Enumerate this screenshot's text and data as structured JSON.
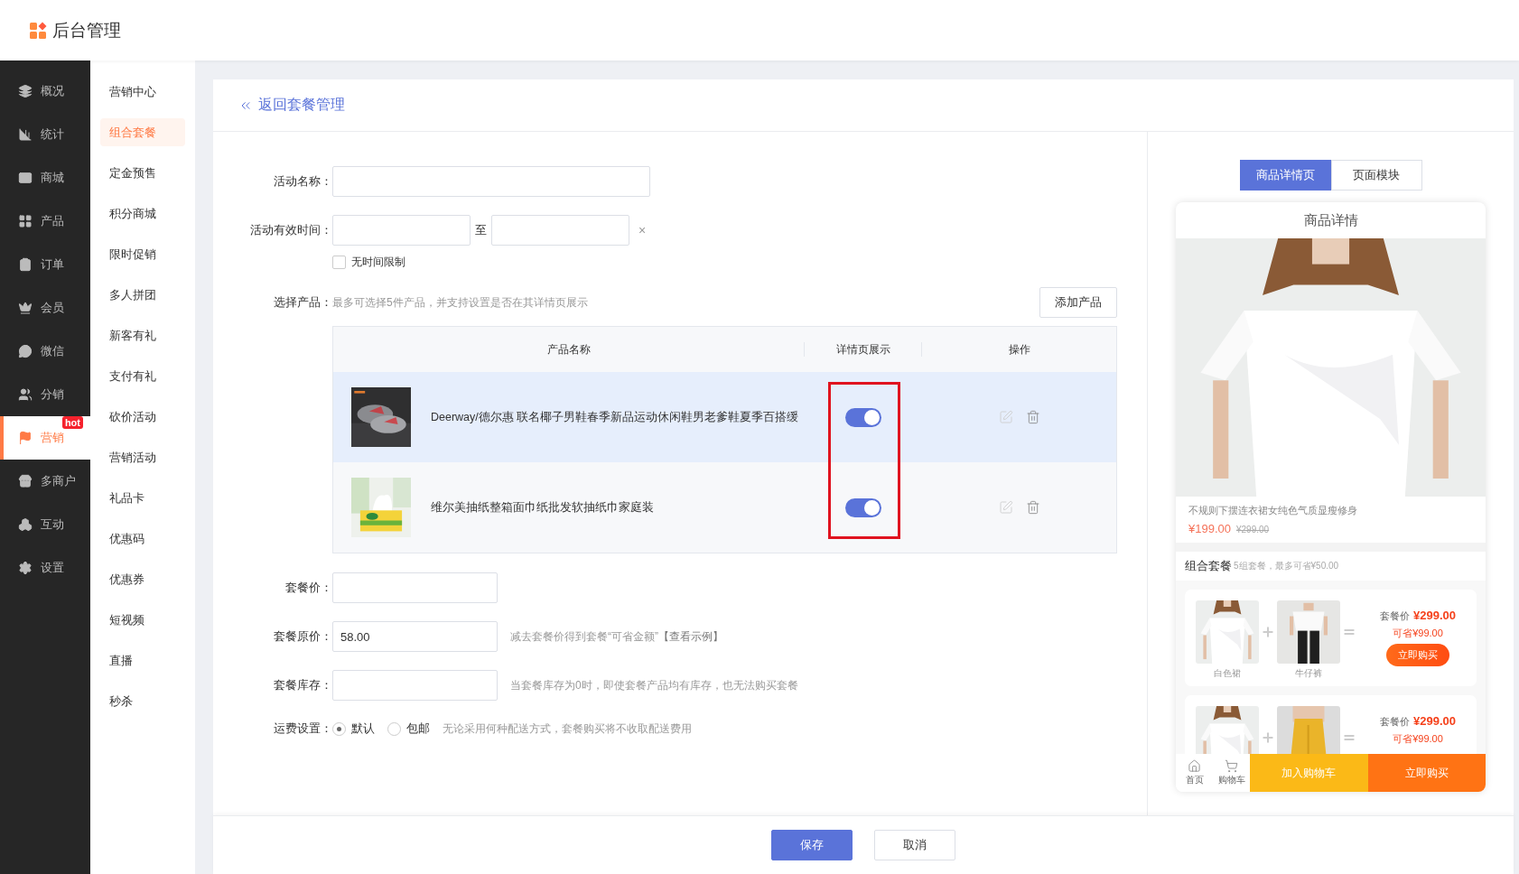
{
  "app": {
    "title": "后台管理"
  },
  "main_nav": [
    {
      "label": "概况",
      "selected": false
    },
    {
      "label": "统计",
      "selected": false
    },
    {
      "label": "商城",
      "selected": false
    },
    {
      "label": "产品",
      "selected": false
    },
    {
      "label": "订单",
      "selected": false
    },
    {
      "label": "会员",
      "selected": false
    },
    {
      "label": "微信",
      "selected": false
    },
    {
      "label": "分销",
      "selected": false
    },
    {
      "label": "营销",
      "selected": true,
      "badge": "hot"
    },
    {
      "label": "多商户",
      "selected": false
    },
    {
      "label": "互动",
      "selected": false
    },
    {
      "label": "设置",
      "selected": false
    }
  ],
  "sub_nav": [
    {
      "label": "营销中心",
      "selected": false
    },
    {
      "label": "组合套餐",
      "selected": true
    },
    {
      "label": "定金预售",
      "selected": false
    },
    {
      "label": "积分商城",
      "selected": false
    },
    {
      "label": "限时促销",
      "selected": false
    },
    {
      "label": "多人拼团",
      "selected": false
    },
    {
      "label": "新客有礼",
      "selected": false
    },
    {
      "label": "支付有礼",
      "selected": false
    },
    {
      "label": "砍价活动",
      "selected": false
    },
    {
      "label": "营销活动",
      "selected": false
    },
    {
      "label": "礼品卡",
      "selected": false
    },
    {
      "label": "优惠码",
      "selected": false
    },
    {
      "label": "优惠券",
      "selected": false
    },
    {
      "label": "短视频",
      "selected": false
    },
    {
      "label": "直播",
      "selected": false
    },
    {
      "label": "秒杀",
      "selected": false
    }
  ],
  "back_link": "返回套餐管理",
  "form": {
    "name_field": {
      "label": "活动名称："
    },
    "valid_time": {
      "label": "活动有效时间：",
      "separator": "至",
      "clear": "×",
      "no_limit": {
        "label": "无时间限制",
        "checked": false
      }
    },
    "products": {
      "label": "选择产品：",
      "hint": "最多可选择5件产品，并支持设置是否在其详情页展示",
      "add_button": "添加产品",
      "columns": [
        "产品名称",
        "详情页展示",
        "操作"
      ],
      "rows": [
        {
          "name": "Deerway/德尔惠 联名椰子男鞋春季新品运动休闲鞋男老爹鞋夏季百搭缓",
          "show_on_detail": true,
          "highlighted": true
        },
        {
          "name": "维尔美抽纸整箱面巾纸批发软抽纸巾家庭装",
          "show_on_detail": true,
          "highlighted": false
        }
      ]
    },
    "package_price": {
      "label": "套餐价："
    },
    "original_price": {
      "label": "套餐原价：",
      "value": "58.00",
      "hint": "减去套餐价得到套餐“可省金额”",
      "link": "【查看示例】"
    },
    "stock": {
      "label": "套餐库存：",
      "hint": "当套餐库存为0时，即使套餐产品均有库存，也无法购买套餐"
    },
    "shipping": {
      "label": "运费设置：",
      "options": [
        {
          "label": "默认",
          "selected": true
        },
        {
          "label": "包邮",
          "selected": false
        }
      ],
      "hint": "无论采用何种配送方式，套餐购买将不收取配送费用"
    }
  },
  "footer": {
    "buttons": [
      {
        "label": "保存",
        "kind": "primary"
      },
      {
        "label": "取消",
        "kind": "default"
      }
    ]
  },
  "preview": {
    "tabs": [
      {
        "label": "商品详情页",
        "selected": true
      },
      {
        "label": "页面模块",
        "selected": false
      }
    ],
    "phone": {
      "title": "商品详情",
      "product_name": "不规则下摆连衣裙女纯色气质显瘦修身",
      "price": "¥199.00",
      "original_price": "¥299.00",
      "bundle_title": "组合套餐",
      "bundle_summary": "5组套餐，最多可省¥50.00",
      "bundles": [
        {
          "items": [
            {
              "kind": "picture",
              "name": "白色裙"
            },
            {
              "kind": "picture",
              "name": "牛仔裤"
            }
          ],
          "price_label": "套餐价",
          "price": "¥299.00",
          "saving": "可省¥99.00",
          "buy": "立即购买"
        },
        {
          "price_label": "套餐价",
          "price": "¥299.00",
          "saving": "可省¥99.00"
        }
      ],
      "bottom_bar": {
        "home": "首页",
        "cart": "购物车",
        "add_to_cart": "加入购物车",
        "buy_now": "立即购买"
      }
    }
  }
}
